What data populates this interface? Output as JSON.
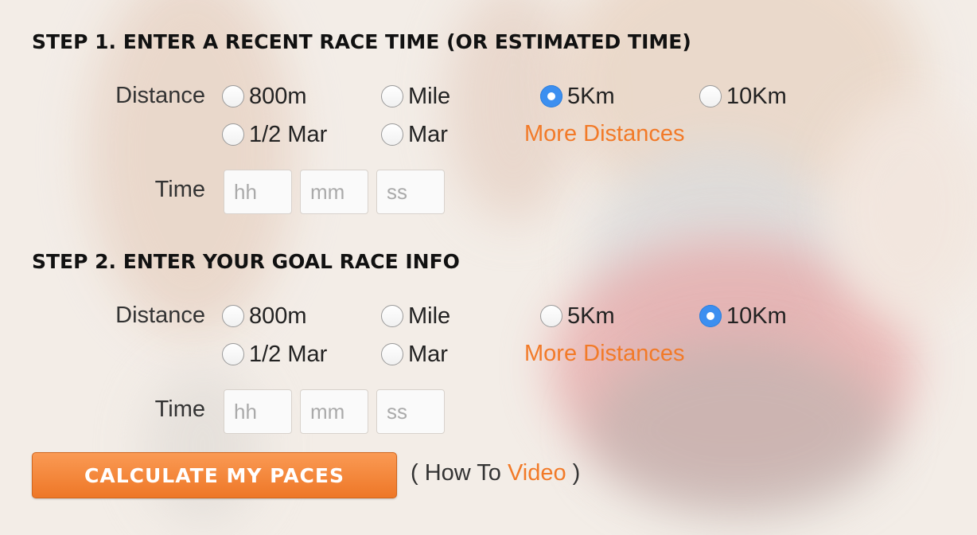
{
  "step1": {
    "title": "STEP 1. ENTER A RECENT RACE TIME (OR ESTIMATED TIME)",
    "distance_label": "Distance",
    "options": [
      "800m",
      "Mile",
      "5Km",
      "10Km",
      "1/2 Mar",
      "Mar"
    ],
    "selected": "5Km",
    "more_distances": "More Distances",
    "time_label": "Time",
    "time_fields": [
      {
        "placeholder": "hh",
        "value": ""
      },
      {
        "placeholder": "mm",
        "value": ""
      },
      {
        "placeholder": "ss",
        "value": ""
      }
    ]
  },
  "step2": {
    "title": "STEP 2. ENTER YOUR GOAL RACE INFO",
    "distance_label": "Distance",
    "options": [
      "800m",
      "Mile",
      "5Km",
      "10Km",
      "1/2 Mar",
      "Mar"
    ],
    "selected": "10Km",
    "more_distances": "More Distances",
    "time_label": "Time",
    "time_fields": [
      {
        "placeholder": "hh",
        "value": ""
      },
      {
        "placeholder": "mm",
        "value": ""
      },
      {
        "placeholder": "ss",
        "value": ""
      }
    ]
  },
  "calculate_button": "CALCULATE MY PACES",
  "howto": {
    "open": "( How To ",
    "link": "Video",
    "close": " )"
  },
  "colors": {
    "accent": "#f27a28",
    "radio_selected": "#3c8ff0",
    "button_top": "#fa9a54",
    "button_bottom": "#ee7727"
  }
}
